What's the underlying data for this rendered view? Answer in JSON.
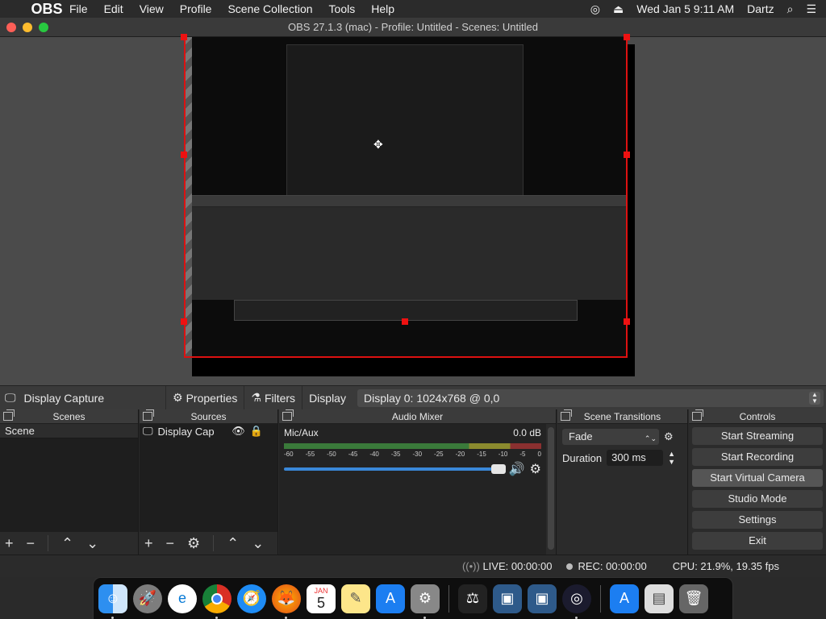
{
  "menubar": {
    "apple": "",
    "app": "OBS",
    "items": [
      "File",
      "Edit",
      "View",
      "Profile",
      "Scene Collection",
      "Tools",
      "Help"
    ],
    "datetime": "Wed Jan 5  9:11 AM",
    "user": "Dartz"
  },
  "window": {
    "title": "OBS 27.1.3 (mac) - Profile: Untitled - Scenes: Untitled"
  },
  "context": {
    "source": "Display Capture",
    "properties": "Properties",
    "filters": "Filters",
    "display_label": "Display",
    "display_value": "Display 0: 1024x768 @ 0,0"
  },
  "scenes": {
    "title": "Scenes",
    "items": [
      "Scene"
    ]
  },
  "sources": {
    "title": "Sources",
    "items": [
      "Display Cap"
    ]
  },
  "mixer": {
    "title": "Audio Mixer",
    "channel": "Mic/Aux",
    "level": "0.0 dB",
    "ticks": [
      "-60",
      "-55",
      "-50",
      "-45",
      "-40",
      "-35",
      "-30",
      "-25",
      "-20",
      "-15",
      "-10",
      "-5",
      "0"
    ],
    "volume": 1.0
  },
  "transitions": {
    "title": "Scene Transitions",
    "selected": "Fade",
    "duration_label": "Duration",
    "duration": "300 ms"
  },
  "controls": {
    "title": "Controls",
    "buttons": [
      "Start Streaming",
      "Start Recording",
      "Start Virtual Camera",
      "Studio Mode",
      "Settings",
      "Exit"
    ]
  },
  "status": {
    "live": "LIVE: 00:00:00",
    "rec": "REC: 00:00:00",
    "cpu": "CPU: 21.9%, 19.35 fps"
  },
  "dock": {
    "calendar_day": "5",
    "calendar_month": "JAN"
  },
  "colors": {
    "selection_red": "#dd1111",
    "accent_blue": "#3a88d9"
  }
}
